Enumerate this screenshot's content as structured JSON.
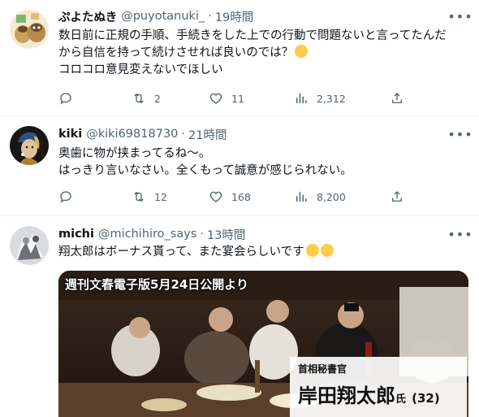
{
  "tweets": [
    {
      "name": "ぷよたぬき",
      "handle": "@puyotanuki_",
      "time": "19時間",
      "lines": [
        "数日前に正規の手順、手続きをした上での行動で問題ないと言ってたんだ",
        "から自信を持って続けさせれば良いのでは？",
        "コロコロ意見変えないでほしい"
      ],
      "emoji": "thinking-face",
      "actions": {
        "reply": "",
        "retweet": "2",
        "like": "11",
        "views": "2,312"
      }
    },
    {
      "name": "kiki",
      "handle": "@kiki69818730",
      "time": "21時間",
      "lines": [
        "奥歯に物が挟まってるね〜。",
        "はっきり言いなさい。全くもって誠意が感じられない。"
      ],
      "actions": {
        "reply": "",
        "retweet": "12",
        "like": "168",
        "views": "8,200"
      }
    },
    {
      "name": "michi",
      "handle": "@michihiro_says",
      "time": "13時間",
      "lines": [
        "翔太郎はボーナス貰って、また宴会らしいです"
      ],
      "emoji": "tears-of-joy",
      "media": {
        "caption_top": "週刊文春電子版5月24日公開より",
        "role": "首相秘書官",
        "person": "岸田翔太郎",
        "honorific": "氏",
        "age": "(32)"
      }
    }
  ],
  "separator": "·",
  "colors": {
    "text": "#0f1419",
    "muted": "#536471",
    "border": "#eff3f4"
  }
}
